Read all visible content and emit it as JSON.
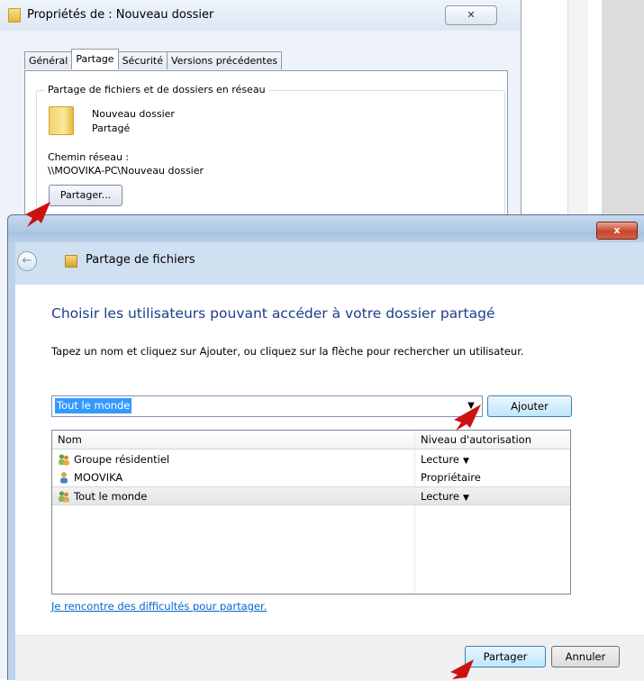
{
  "properties_window": {
    "title": "Propriétés de : Nouveau dossier",
    "close_glyph": "✕",
    "tabs": [
      {
        "label": "Général",
        "active": false
      },
      {
        "label": "Partage",
        "active": true
      },
      {
        "label": "Sécurité",
        "active": false
      },
      {
        "label": "Versions précédentes",
        "active": false
      }
    ],
    "group_title": "Partage de fichiers et de dossiers en réseau",
    "folder_name": "Nouveau dossier",
    "folder_status": "Partagé",
    "network_path_label": "Chemin réseau :",
    "network_path": "\\\\MOOVIKA-PC\\Nouveau dossier",
    "share_button": "Partager..."
  },
  "wizard": {
    "close_glyph": "x",
    "nav": {
      "back_glyph": "←",
      "title": "Partage de fichiers",
      "icon": "sharing-people-icon"
    },
    "heading": "Choisir les utilisateurs pouvant accéder à votre dossier partagé",
    "instructions": "Tapez un nom et cliquez sur Ajouter, ou cliquez sur la flèche pour rechercher un utilisateur.",
    "user_input": {
      "value": "Tout le monde",
      "arrow_glyph": "▼"
    },
    "add_button": "Ajouter",
    "table": {
      "columns": [
        "Nom",
        "Niveau d'autorisation"
      ],
      "rows": [
        {
          "name": "Groupe résidentiel",
          "level": "Lecture",
          "has_dropdown": true,
          "icon": "group-icon",
          "selected": false
        },
        {
          "name": "MOOVIKA",
          "level": "Propriétaire",
          "has_dropdown": false,
          "icon": "user-icon",
          "selected": false
        },
        {
          "name": "Tout le monde",
          "level": "Lecture",
          "has_dropdown": true,
          "icon": "group-icon",
          "selected": true
        }
      ],
      "dropdown_glyph": "▼"
    },
    "help_link": "Je rencontre des difficultés pour partager.",
    "share_button": "Partager",
    "cancel_button": "Annuler"
  },
  "colors": {
    "heading": "#1e3c8e",
    "link": "#0066cc",
    "selection": "#3399ff",
    "annotation_arrow": "#cc1111"
  }
}
